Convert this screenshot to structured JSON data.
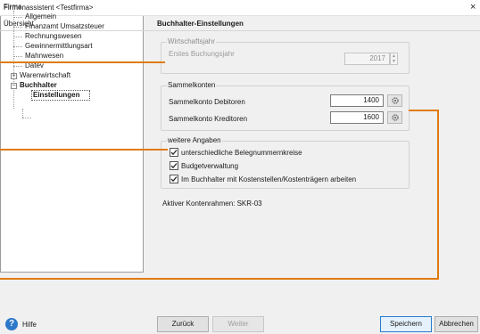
{
  "window": {
    "title": "Firmenassistent <Testfirma>",
    "close_glyph": "×"
  },
  "headers": {
    "left": "Übersicht",
    "right": "Buchhalter-Einstellungen"
  },
  "tree": {
    "root": "Firma",
    "items": [
      "Allgemein",
      "Finanzamt Umsatzsteuer",
      "Rechnungswesen",
      "Gewinnermittlungsart",
      "Mahnwesen",
      "Datev",
      "Warenwirtschaft",
      "Buchhalter"
    ],
    "child": "Einstellungen"
  },
  "wirtschaftsjahr": {
    "label": "Wirtschaftsjahr",
    "erstes_label": "Erstes Buchungsjahr",
    "erstes_value": "2017"
  },
  "sammelkonten": {
    "label": "Sammelkonten",
    "debitoren_label": "Sammelkonto Debitoren",
    "debitoren_value": "1400",
    "kreditoren_label": "Sammelkonto Kreditoren",
    "kreditoren_value": "1600"
  },
  "weitere": {
    "label": "weitere Angaben",
    "options": [
      {
        "label": "unterschiedliche Belegnummernkreise",
        "checked": true
      },
      {
        "label": "Budgetverwaltung",
        "checked": true
      },
      {
        "label": "Im Buchhalter mit Kostenstellen/Kostenträgern arbeiten",
        "checked": true
      }
    ]
  },
  "kontenrahmen": "Aktiver Kontenrahmen: SKR-03",
  "buttons": {
    "help": "Hilfe",
    "back": "Zurück",
    "next": "Weiter",
    "save": "Speichern",
    "cancel": "Abbrechen"
  },
  "colors": {
    "callout": "#e07b10",
    "help_icon": "#2d78c8",
    "primary_border": "#2a7bd0"
  },
  "icons": {
    "gear": "gear-icon",
    "help": "help-icon",
    "check": "check-icon",
    "spinner": "spinner-arrows-icon"
  }
}
